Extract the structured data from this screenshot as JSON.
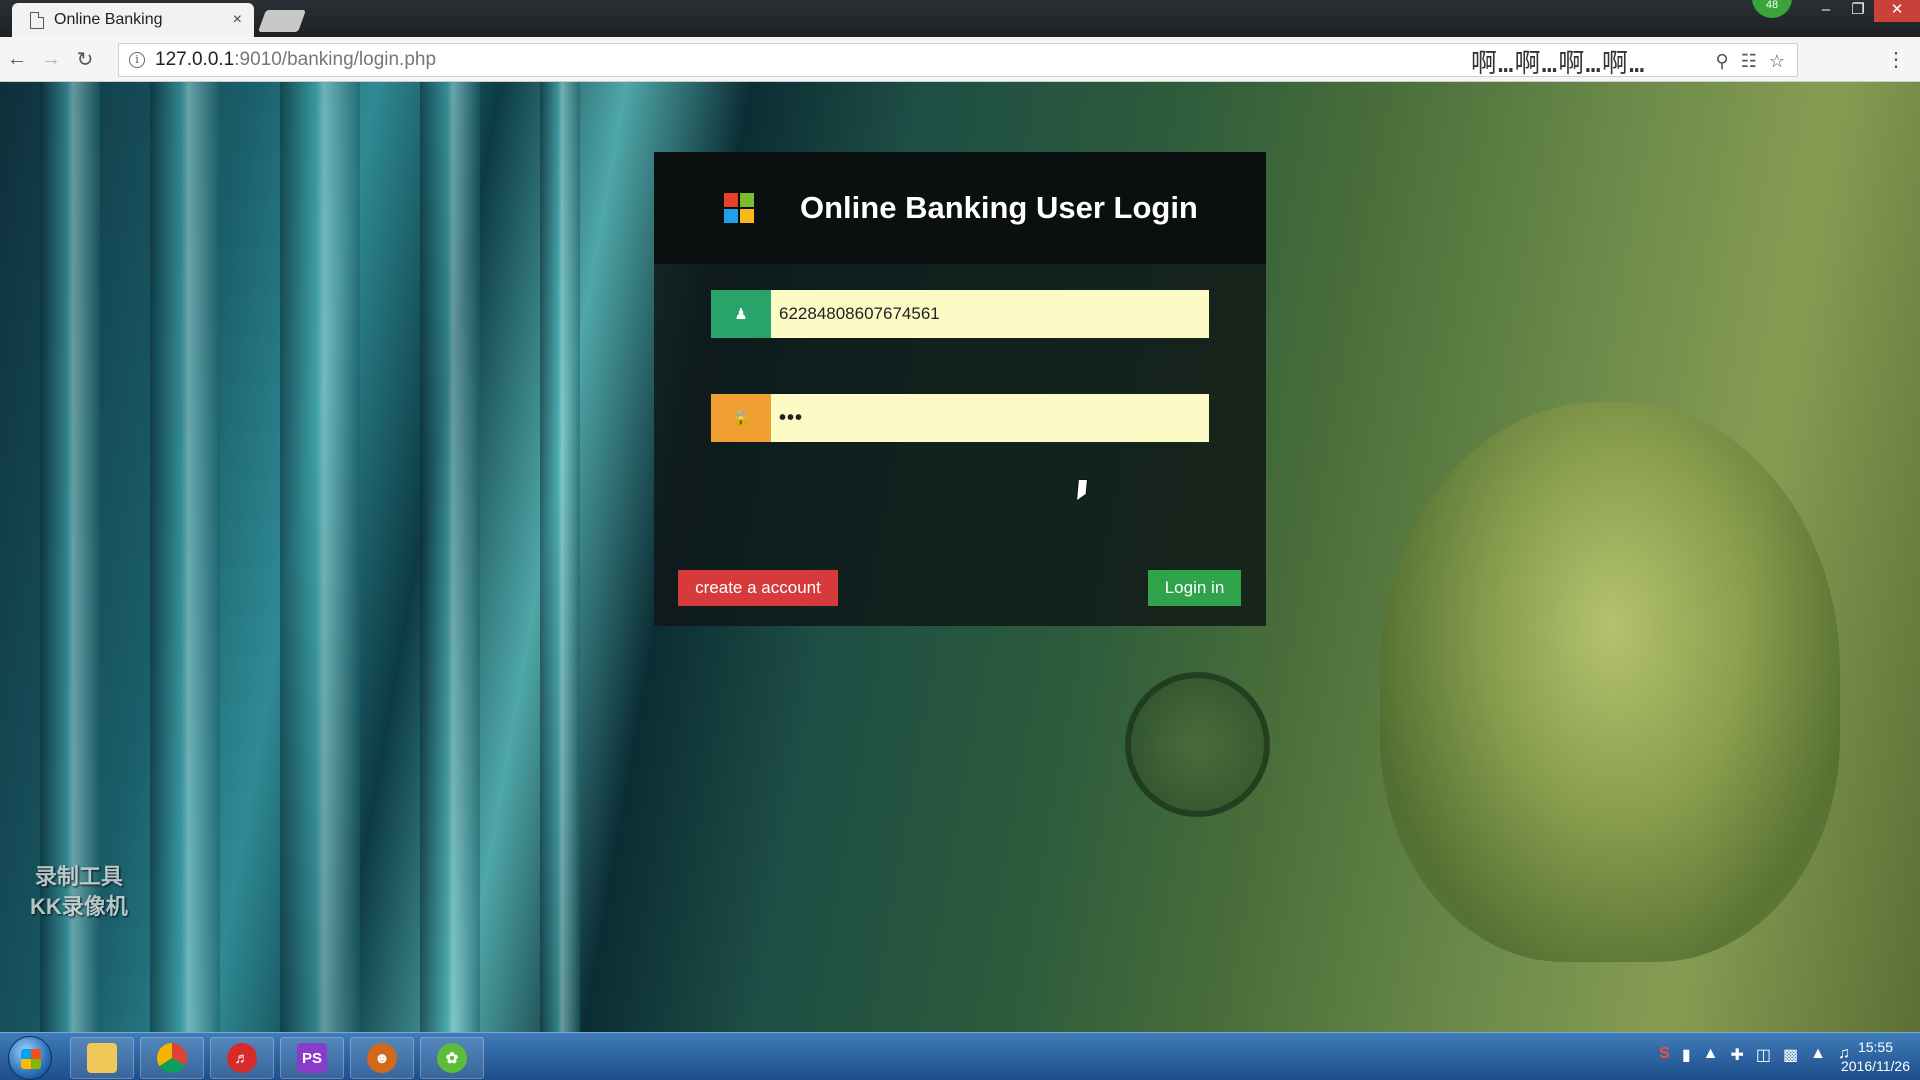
{
  "browser": {
    "tab_title": "Online Banking",
    "tab_close": "×",
    "url_host": "127.0.0.1",
    "url_path": ":9010/banking/login.php",
    "extension_text": "啊…啊…啊…啊…",
    "badge": "48"
  },
  "login": {
    "title": "Online Banking User Login",
    "username_value": "62284808607674561",
    "password_value": "•••",
    "create_label": "create a account",
    "login_label": "Login in"
  },
  "watermark": {
    "line1": "录制工具",
    "line2": "KK录像机"
  },
  "taskbar": {
    "time": "15:55",
    "date": "2016/11/26"
  }
}
